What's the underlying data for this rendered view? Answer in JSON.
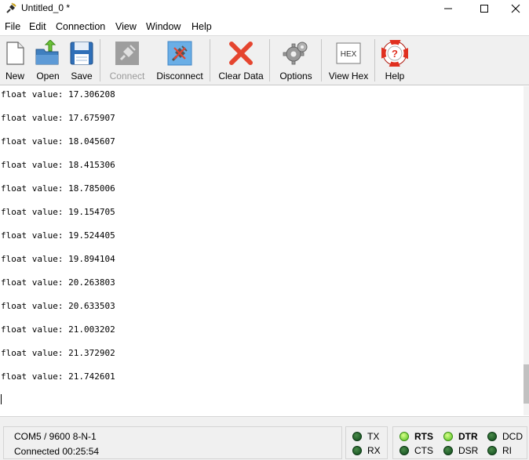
{
  "window": {
    "title": "Untitled_0 *",
    "controls": {
      "minimize": "—",
      "maximize": "☐",
      "close": "✕"
    }
  },
  "menu": [
    "File",
    "Edit",
    "Connection",
    "View",
    "Window",
    "Help"
  ],
  "toolbar": {
    "new": "New",
    "open": "Open",
    "save": "Save",
    "connect": "Connect",
    "disconnect": "Disconnect",
    "clear_data": "Clear Data",
    "options": "Options",
    "view_hex": "View Hex",
    "hex_badge": "HEX",
    "help": "Help"
  },
  "terminal": {
    "lines": [
      "float value: 17.306208",
      "float value: 17.675907",
      "float value: 18.045607",
      "float value: 18.415306",
      "float value: 18.785006",
      "float value: 19.154705",
      "float value: 19.524405",
      "float value: 19.894104",
      "float value: 20.263803",
      "float value: 20.633503",
      "float value: 21.003202",
      "float value: 21.372902",
      "float value: 21.742601"
    ]
  },
  "status": {
    "port": "COM5 / 9600 8-N-1",
    "connected": "Connected 00:25:54"
  },
  "signals": {
    "tx": "TX",
    "rx": "RX",
    "rts": "RTS",
    "cts": "CTS",
    "dtr": "DTR",
    "dsr": "DSR",
    "dcd": "DCD",
    "ri": "RI"
  },
  "colors": {
    "led_on": "#7ed321",
    "led_off": "#1f5e2a",
    "clear_icon": "#e5452f",
    "help_icon": "#e03020"
  }
}
